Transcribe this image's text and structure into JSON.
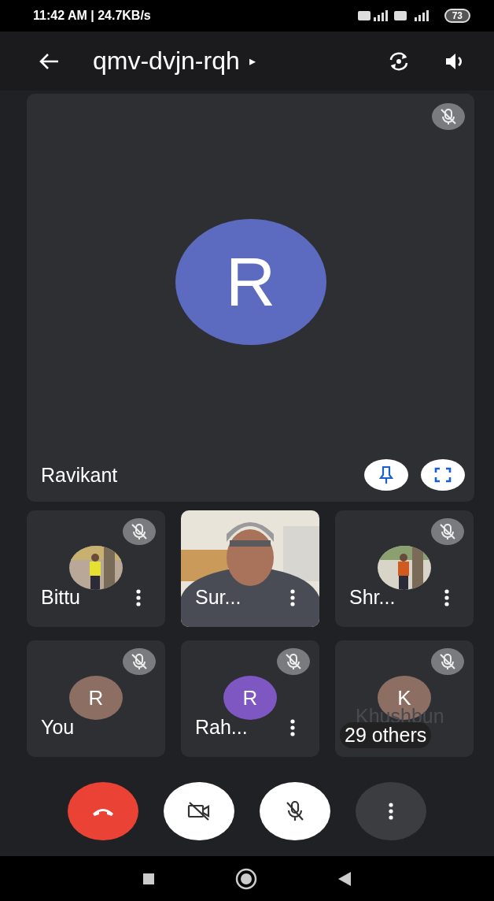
{
  "status_bar": {
    "time": "11:42 AM | 24.7KB/s",
    "battery": "73"
  },
  "top_bar": {
    "meeting_code": "qmv-dvjn-rqh",
    "caret": "▸"
  },
  "main_tile": {
    "name": "Ravikant",
    "initial": "R",
    "color": "#5c6bc0",
    "muted": true
  },
  "tiles": [
    {
      "kind": "photo-avatar",
      "name": "Bittu",
      "muted": true,
      "menu": true
    },
    {
      "kind": "video",
      "name": "Sur...",
      "muted": false,
      "menu": true
    },
    {
      "kind": "photo-avatar",
      "name": "Shr...",
      "muted": true,
      "menu": true
    },
    {
      "kind": "avatar",
      "name": "You",
      "initial": "R",
      "color": "#8d6e63",
      "muted": true,
      "menu": false
    },
    {
      "kind": "avatar",
      "name": "Rah...",
      "initial": "R",
      "color": "#7e57c2",
      "muted": true,
      "menu": true
    },
    {
      "kind": "avatar",
      "name": "Khushbun",
      "initial": "K",
      "color": "#8d6e63",
      "muted": true,
      "menu": false,
      "overlay": "29 others"
    }
  ]
}
